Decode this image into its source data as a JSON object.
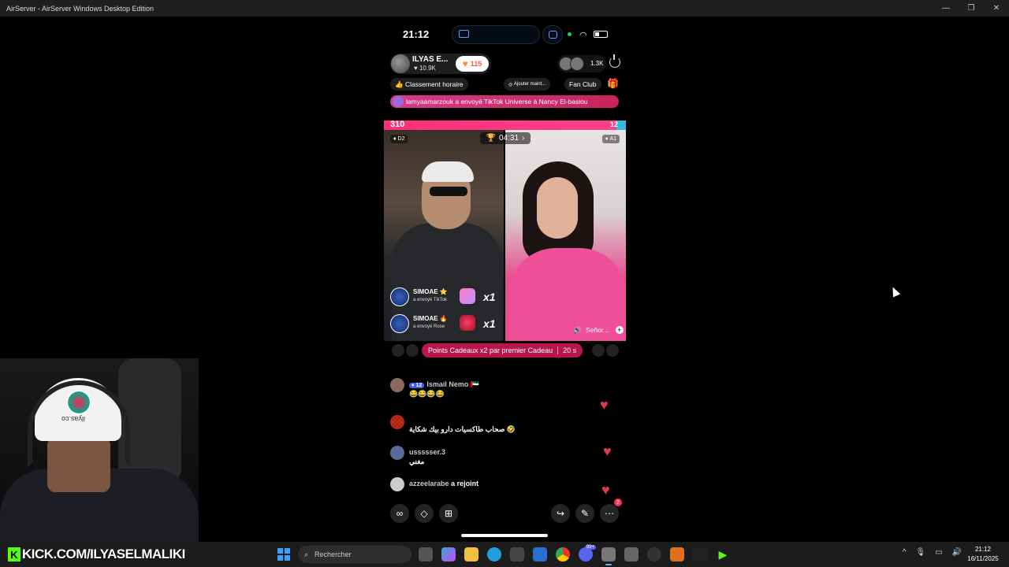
{
  "window": {
    "title": "AirServer - AirServer Windows Desktop Edition"
  },
  "phone": {
    "time": "21:12",
    "host": {
      "name": "ILYAS E...",
      "likes": "10.9K",
      "follow_count": "115"
    },
    "viewers": "1.3K",
    "chips": {
      "ranking": "Classement horaire",
      "add": "Ajouter maint...",
      "fanclub": "Fan Club"
    },
    "banner": "lamyaamarzouk a envoyé TikTok Universe à Nancy El-basiou",
    "battle": {
      "score_left": "310",
      "score_right": "12",
      "left_share": 0.96,
      "timer": "04:31",
      "rank_left": "D2",
      "rank_right": "A1"
    },
    "gifts": [
      {
        "name": "SIMOAE",
        "sub": "a envoyé  TikTok",
        "count": "x1"
      },
      {
        "name": "SIMOAE",
        "sub": "a envoyé  Rose",
        "count": "x1"
      }
    ],
    "right_label": "Señor...",
    "points": {
      "text": "Points Cadeaux x2 par premier Cadeau",
      "seconds": "20 s"
    },
    "comments": [
      {
        "level": "12",
        "name": "Ismail Nemo",
        "text": "😂😂😂😂"
      },
      {
        "name": "",
        "text": "صحاب طاكسيات دارو بيك شكاية 🤣"
      },
      {
        "name": "ussssser.3",
        "text": "مغني"
      },
      {
        "name": "azzeelarabe",
        "text": "a rejoint"
      }
    ],
    "badge_count": "2"
  },
  "webcam": {
    "cap_text": "ilyas.co"
  },
  "taskbar": {
    "kick_url": "KICK.COM/ILYASELMALIKI",
    "search_placeholder": "Rechercher",
    "time": "21:12",
    "date": "16/11/2025",
    "discord_badge": "99+"
  },
  "colors": {
    "accent_pink": "#ff2f7a",
    "battle_blue": "#36b8e0",
    "kick_green": "#53fc18"
  }
}
